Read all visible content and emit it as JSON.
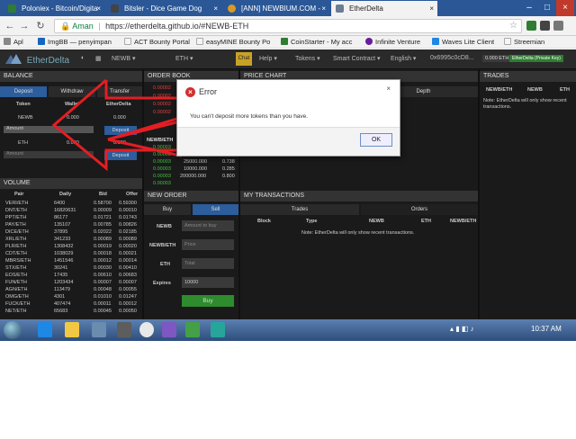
{
  "browser": {
    "tabs": [
      {
        "label": "Poloniex - Bitcoin/Digita",
        "color": "#2e7d32"
      },
      {
        "label": "Bitsler - Dice Game Dog",
        "color": "#444444"
      },
      {
        "label": "[ANN] NEWBIUM.COM -",
        "color": "#d99a24"
      },
      {
        "label": "EtherDelta",
        "color": "#6b7c93"
      }
    ],
    "secure_label": "Aman",
    "url": "https://etherdelta.github.io/#NEWB-ETH",
    "bookmarks": [
      "Apl",
      "ImgBB — penyimpan",
      "ACT Bounty Portal",
      "easyMINE Bounty Po",
      "CoinStarter - My acc",
      "Infinite Venture",
      "Waves Lite Client",
      "Streemian"
    ]
  },
  "app": {
    "logo": "EtherDelta",
    "nav": {
      "pair": "NEWB ▾",
      "base": "ETH ▾",
      "chat": "Chat",
      "help": "Help ▾",
      "tokens": "Tokens ▾",
      "contract": "Smart Contract ▾",
      "lang": "English ▾",
      "account": "0x6995c0cD8...",
      "balance": "0.000 ETH",
      "key": "EtherDelta (Private Key)"
    },
    "balance": {
      "title": "BALANCE",
      "tabs": [
        "Deposit",
        "Withdraw",
        "Transfer"
      ],
      "cols": [
        "Token",
        "Wallet",
        "EtherDelta"
      ],
      "rows": [
        {
          "token": "NEWB",
          "wallet": "0.000",
          "ed": "0.000"
        },
        {
          "token": "ETH",
          "wallet": "0.000",
          "ed": "0.000"
        }
      ],
      "amount_placeholder": "Amount",
      "deposit_btn": "Deposit"
    },
    "orderbook": {
      "title": "ORDER BOOK",
      "header": "NEWB/ETH",
      "asks": [
        "0.00002",
        "0.00002",
        "0.00002",
        "0.00002"
      ],
      "bids": [
        "0.00003",
        "0.00003",
        "0.00003",
        "0.00003",
        "0.00003",
        "0.00003"
      ],
      "rows": [
        {
          "amt": "25000.000",
          "eth": "0.738"
        },
        {
          "amt": "10000.000",
          "eth": "0.285"
        },
        {
          "amt": "200000.000",
          "eth": "0.800"
        }
      ]
    },
    "chart": {
      "title": "PRICE CHART",
      "depth_tab": "Depth"
    },
    "trades": {
      "title": "TRADES",
      "cols": [
        "NEWB/ETH",
        "NEWB",
        "ETH"
      ],
      "note": "Note: EtherDelta will only show recent transactions."
    },
    "volume": {
      "title": "VOLUME",
      "cols": [
        "Pair",
        "Daily",
        "Bid",
        "Offer"
      ],
      "rows": [
        [
          "VERI/ETH",
          "6400",
          "0.58700",
          "0.59300"
        ],
        [
          "DNT/ETH",
          "16820631",
          "0.00009",
          "0.00010"
        ],
        [
          "PPT/ETH",
          "86177",
          "0.01721",
          "0.01743"
        ],
        [
          "PAY/ETH",
          "135107",
          "0.00785",
          "0.00826"
        ],
        [
          "DICE/ETH",
          "37895",
          "0.02022",
          "0.02185"
        ],
        [
          "XRL/ETH",
          "341233",
          "0.00089",
          "0.00089"
        ],
        [
          "PLR/ETH",
          "1308432",
          "0.00019",
          "0.00020"
        ],
        [
          "CDT/ETH",
          "1038029",
          "0.00018",
          "0.00021"
        ],
        [
          "MBRS/ETH",
          "1451546",
          "0.00012",
          "0.00014"
        ],
        [
          "STX/ETH",
          "30241",
          "0.00030",
          "0.00410"
        ],
        [
          "EOS/ETH",
          "17435",
          "0.00610",
          "0.00683"
        ],
        [
          "FUN/ETH",
          "1203434",
          "0.00007",
          "0.00007"
        ],
        [
          "AGN/ETH",
          "113479",
          "0.00048",
          "0.00055"
        ],
        [
          "OMG/ETH",
          "4301",
          "0.01010",
          "0.01247"
        ],
        [
          "FUCK/ETH",
          "407474",
          "0.00011",
          "0.00012"
        ],
        [
          "NET/ETH",
          "65683",
          "0.00045",
          "0.00050"
        ]
      ]
    },
    "new_order": {
      "title": "NEW ORDER",
      "tabs": [
        "Buy",
        "Sell"
      ],
      "labels": [
        "NEWB",
        "NEWB/ETH",
        "ETH",
        "Expires"
      ],
      "placeholders": [
        "Amount to buy",
        "Price",
        "Total"
      ],
      "expires_value": "10000",
      "buy_btn": "Buy"
    },
    "my_tx": {
      "title": "MY TRANSACTIONS",
      "tabs": [
        "Trades",
        "Orders"
      ],
      "cols": [
        "Block",
        "Type",
        "NEWB",
        "ETH",
        "NEWB/ETH"
      ],
      "note": "Note: EtherDelta will only show recent transactions."
    }
  },
  "dialog": {
    "title": "Error",
    "message": "You can't deposit more tokens than you have.",
    "ok": "OK",
    "close": "×"
  },
  "taskbar": {
    "time": "10:37 AM"
  }
}
